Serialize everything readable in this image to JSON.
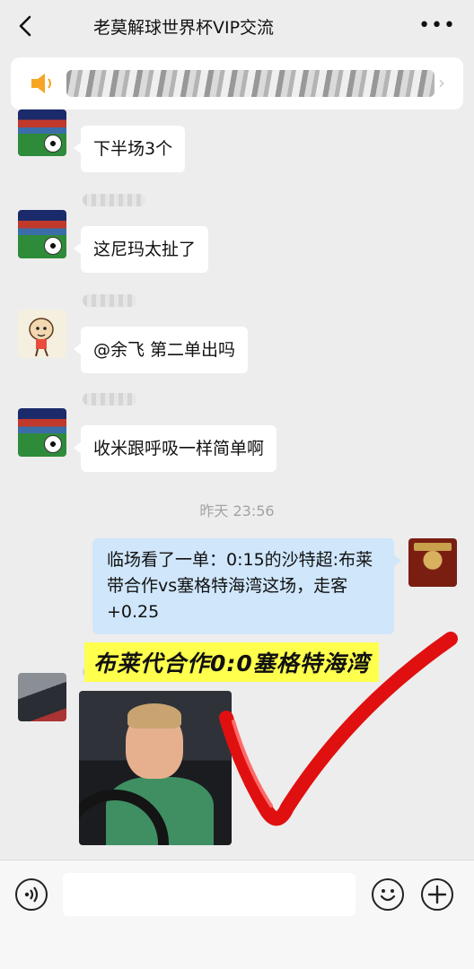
{
  "header": {
    "back_icon": "chevron-left-icon",
    "title": "老莫解球世界杯VIP交流",
    "more_icon": "more-dots-icon",
    "more_glyph": "•••"
  },
  "announcement": {
    "icon": "speaker-icon",
    "chevron": "›"
  },
  "messages": [
    {
      "avatar": "soccer-stadium",
      "text": "下半场3个"
    },
    {
      "avatar": "soccer-stadium",
      "text": "这尼玛太扯了"
    },
    {
      "avatar": "cartoon-kid",
      "text": "@余飞 第二单出吗"
    },
    {
      "avatar": "soccer-stadium",
      "text": "收米跟呼吸一样简单啊"
    }
  ],
  "timestamp": "昨天 23:56",
  "my_message": {
    "avatar": "tea-house",
    "text": "临场看了一单：0:15的沙特超:布莱带合作vs塞格特海湾这场，走客+0.25"
  },
  "image_message": {
    "avatar": "car",
    "banner_text": "布莱代合作0:0塞格特海湾"
  },
  "colors": {
    "background": "#ededed",
    "bubble": "#ffffff",
    "quote_bubble": "#cfe6fb",
    "banner": "#ffff4d",
    "checkmark": "#e01010",
    "timestamp": "#a3a3a3"
  },
  "input_bar": {
    "voice_icon": "voice-icon",
    "emoji_icon": "emoji-icon",
    "plus_icon": "plus-icon"
  }
}
